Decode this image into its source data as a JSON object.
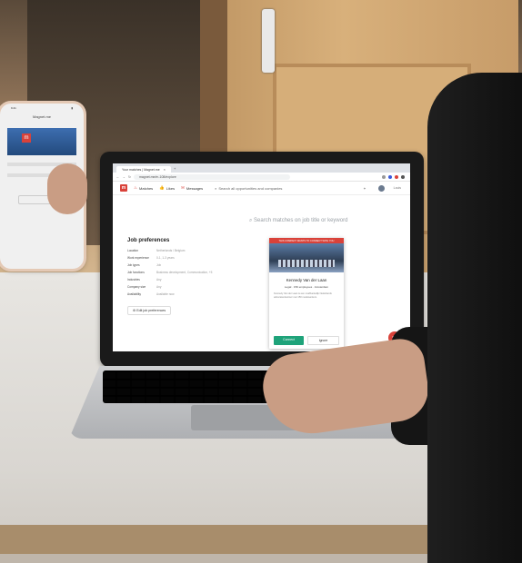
{
  "browser": {
    "tab_title": "Your matches | Magnet.me",
    "tab_close": "×",
    "tab_new": "+",
    "url": "magnet.me/m-108/explore"
  },
  "app": {
    "logo": "m",
    "nav": [
      {
        "label": "Matches",
        "icon": "flame-icon"
      },
      {
        "label": "Likes",
        "icon": "thumbs-up-icon"
      },
      {
        "label": "Messages",
        "icon": "envelope-icon"
      }
    ],
    "search_placeholder": "Search all opportunities and companies",
    "user": "Louis"
  },
  "main": {
    "search_prompt": "Search matches on job title or keyword"
  },
  "preferences": {
    "title": "Job preferences",
    "rows": [
      {
        "label": "Location",
        "value": "Netherlands / Belgium"
      },
      {
        "label": "Work experience",
        "value": "0-1, 1-3 years"
      },
      {
        "label": "Job types",
        "value": "Job"
      },
      {
        "label": "Job functions",
        "value": "Business development, Communication, +5"
      },
      {
        "label": "Industries",
        "value": "Any"
      },
      {
        "label": "Company size",
        "value": "Any"
      },
      {
        "label": "Availability",
        "value": "Available now"
      }
    ],
    "edit_label": "Edit job preferences"
  },
  "card": {
    "banner": "THIS COMPANY WANTS TO CONNECT WITH YOU",
    "name": "Kennedy Van der Laan",
    "meta": "Legal · 150 employees · Amsterdam",
    "description": "Kennedy Van der Laan is een onafhankelijk Nederlands advocatenkantoor met 150 medewerkers.",
    "connect_label": "Connect",
    "ignore_label": "Ignore"
  },
  "phone": {
    "time": "9:41",
    "title": "Magnet.me"
  },
  "colors": {
    "brand": "#d9423a",
    "connect": "#1fa37a"
  }
}
